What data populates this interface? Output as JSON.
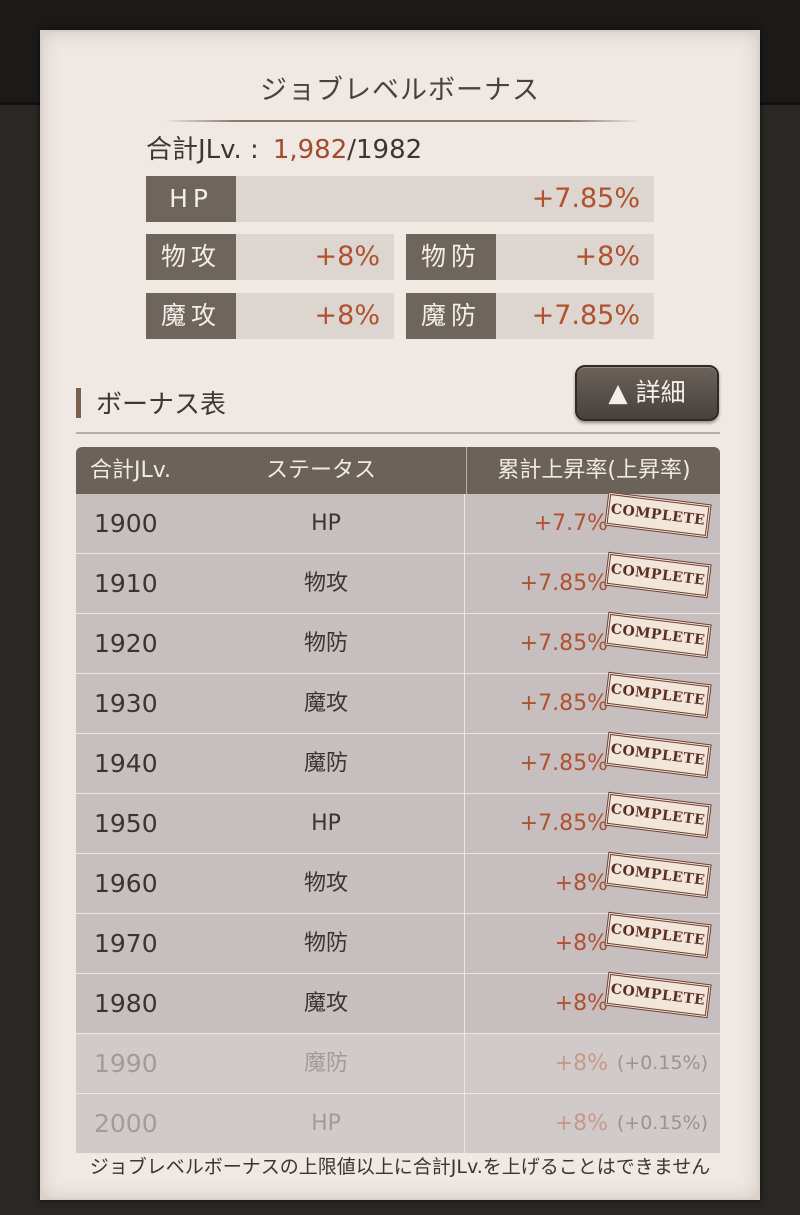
{
  "panel": {
    "title": "ジョブレベルボーナス",
    "total_label": "合計JLv. :",
    "total_current": "1,982",
    "total_max": "/1982"
  },
  "stats": [
    {
      "label": "HP",
      "value": "+7.85%"
    },
    {
      "label": "物攻",
      "value": "+8%"
    },
    {
      "label": "物防",
      "value": "+8%"
    },
    {
      "label": "魔攻",
      "value": "+8%"
    },
    {
      "label": "魔防",
      "value": "+7.85%"
    }
  ],
  "section": {
    "title": "ボーナス表",
    "detail_button": "▲ 詳細"
  },
  "table": {
    "headers": [
      "合計JLv.",
      "ステータス",
      "累計上昇率(上昇率)"
    ],
    "rows": [
      {
        "lv": "1900",
        "status": "HP",
        "rate": "+7.7%",
        "inc": "",
        "complete": true
      },
      {
        "lv": "1910",
        "status": "物攻",
        "rate": "+7.85%",
        "inc": "",
        "complete": true
      },
      {
        "lv": "1920",
        "status": "物防",
        "rate": "+7.85%",
        "inc": "",
        "complete": true
      },
      {
        "lv": "1930",
        "status": "魔攻",
        "rate": "+7.85%",
        "inc": "",
        "complete": true
      },
      {
        "lv": "1940",
        "status": "魔防",
        "rate": "+7.85%",
        "inc": "",
        "complete": true
      },
      {
        "lv": "1950",
        "status": "HP",
        "rate": "+7.85%",
        "inc": "",
        "complete": true
      },
      {
        "lv": "1960",
        "status": "物攻",
        "rate": "+8%",
        "inc": "",
        "complete": true
      },
      {
        "lv": "1970",
        "status": "物防",
        "rate": "+8%",
        "inc": "",
        "complete": true
      },
      {
        "lv": "1980",
        "status": "魔攻",
        "rate": "+8%",
        "inc": "",
        "complete": true
      },
      {
        "lv": "1990",
        "status": "魔防",
        "rate": "+8%",
        "inc": "(+0.15%)",
        "complete": false
      },
      {
        "lv": "2000",
        "status": "HP",
        "rate": "+8%",
        "inc": "(+0.15%)",
        "complete": false
      }
    ],
    "stamp_text": "COMPLETE"
  },
  "footer": "ジョブレベルボーナスの上限値以上に合計JLv.を上げることはできません",
  "colors": {
    "accent": "#b0512f",
    "label_bg": "#6e655d",
    "panel_bg": "#efe8e3"
  }
}
